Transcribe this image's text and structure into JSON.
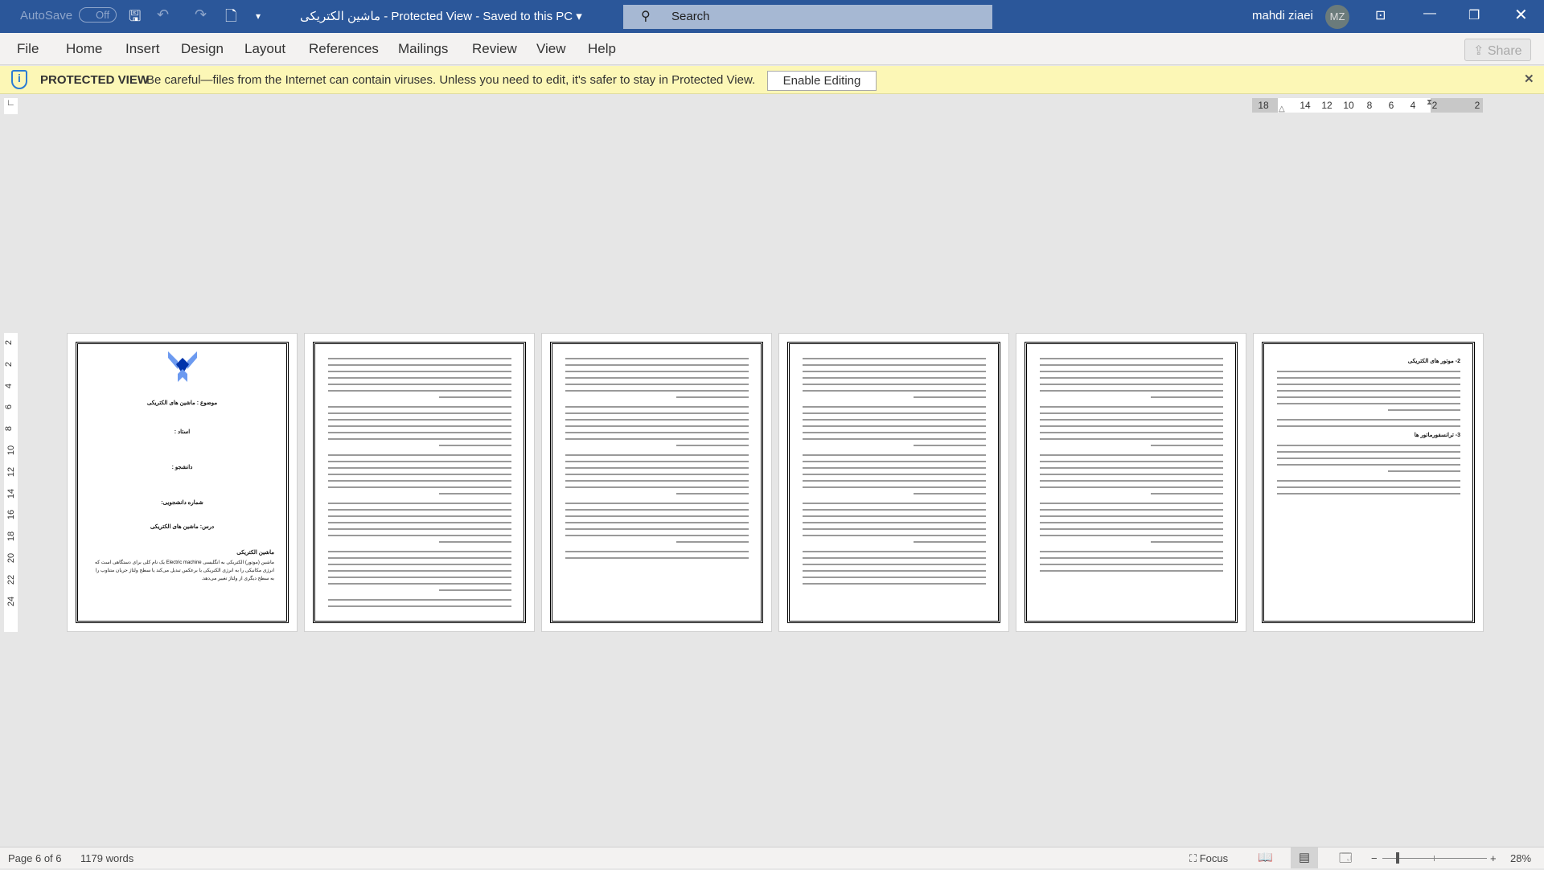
{
  "titlebar": {
    "autosave_label": "AutoSave",
    "autosave_state": "Off",
    "doc_title": "ماشین الکتریکی",
    "mode": "Protected View",
    "saved": "Saved to this PC",
    "search_placeholder": "Search",
    "user_name": "mahdi ziaei",
    "avatar_initials": "MZ"
  },
  "ribbon": {
    "tabs": [
      "File",
      "Home",
      "Insert",
      "Design",
      "Layout",
      "References",
      "Mailings",
      "Review",
      "View",
      "Help"
    ],
    "share_label": "Share"
  },
  "protected_view": {
    "title": "PROTECTED VIEW",
    "message": "Be careful—files from the Internet can contain viruses. Unless you need to edit, it's safer to stay in Protected View.",
    "button": "Enable Editing"
  },
  "ruler": {
    "horizontal": [
      "18",
      "14",
      "12",
      "10",
      "8",
      "6",
      "4",
      "2",
      "2"
    ],
    "vertical": [
      "2",
      "2",
      "4",
      "6",
      "8",
      "10",
      "12",
      "14",
      "16",
      "18",
      "20",
      "22",
      "24"
    ]
  },
  "pages": [
    {
      "cover": {
        "subject": "موضوع : ماشین های الکتریکی",
        "teacher": "استاد :",
        "student": "دانشجو :",
        "student_id": "شماره دانشجویی:",
        "course": "درس: ماشین های الکتریکی",
        "heading": "ماشین الکتریکی",
        "body": "ماشین (موتور) الکتریکی به انگلیسی Electric machine یک نام کلی برای دستگاهی است که انرژی مکانیکی را به انرژی الکتریکی یا برعکس تبدیل می‌کند یا سطح ولتاژ جریان متناوب را به سطح دیگری از ولتاژ تغییر می‌دهد."
      }
    },
    {
      "lines": 38
    },
    {
      "lines": 30
    },
    {
      "lines": 34
    },
    {
      "lines": 32
    },
    {
      "headings": [
        "2- موتور های الکتریکی",
        "3- ترانسفورماتور ها"
      ],
      "lines": 17
    }
  ],
  "status": {
    "page": "Page 6 of 6",
    "words": "1179 words",
    "focus": "Focus",
    "zoom": "28%",
    "zoom_fraction": 0.28
  },
  "colors": {
    "titlebar": "#2b579a",
    "protected_bar": "#fcf7b6"
  }
}
